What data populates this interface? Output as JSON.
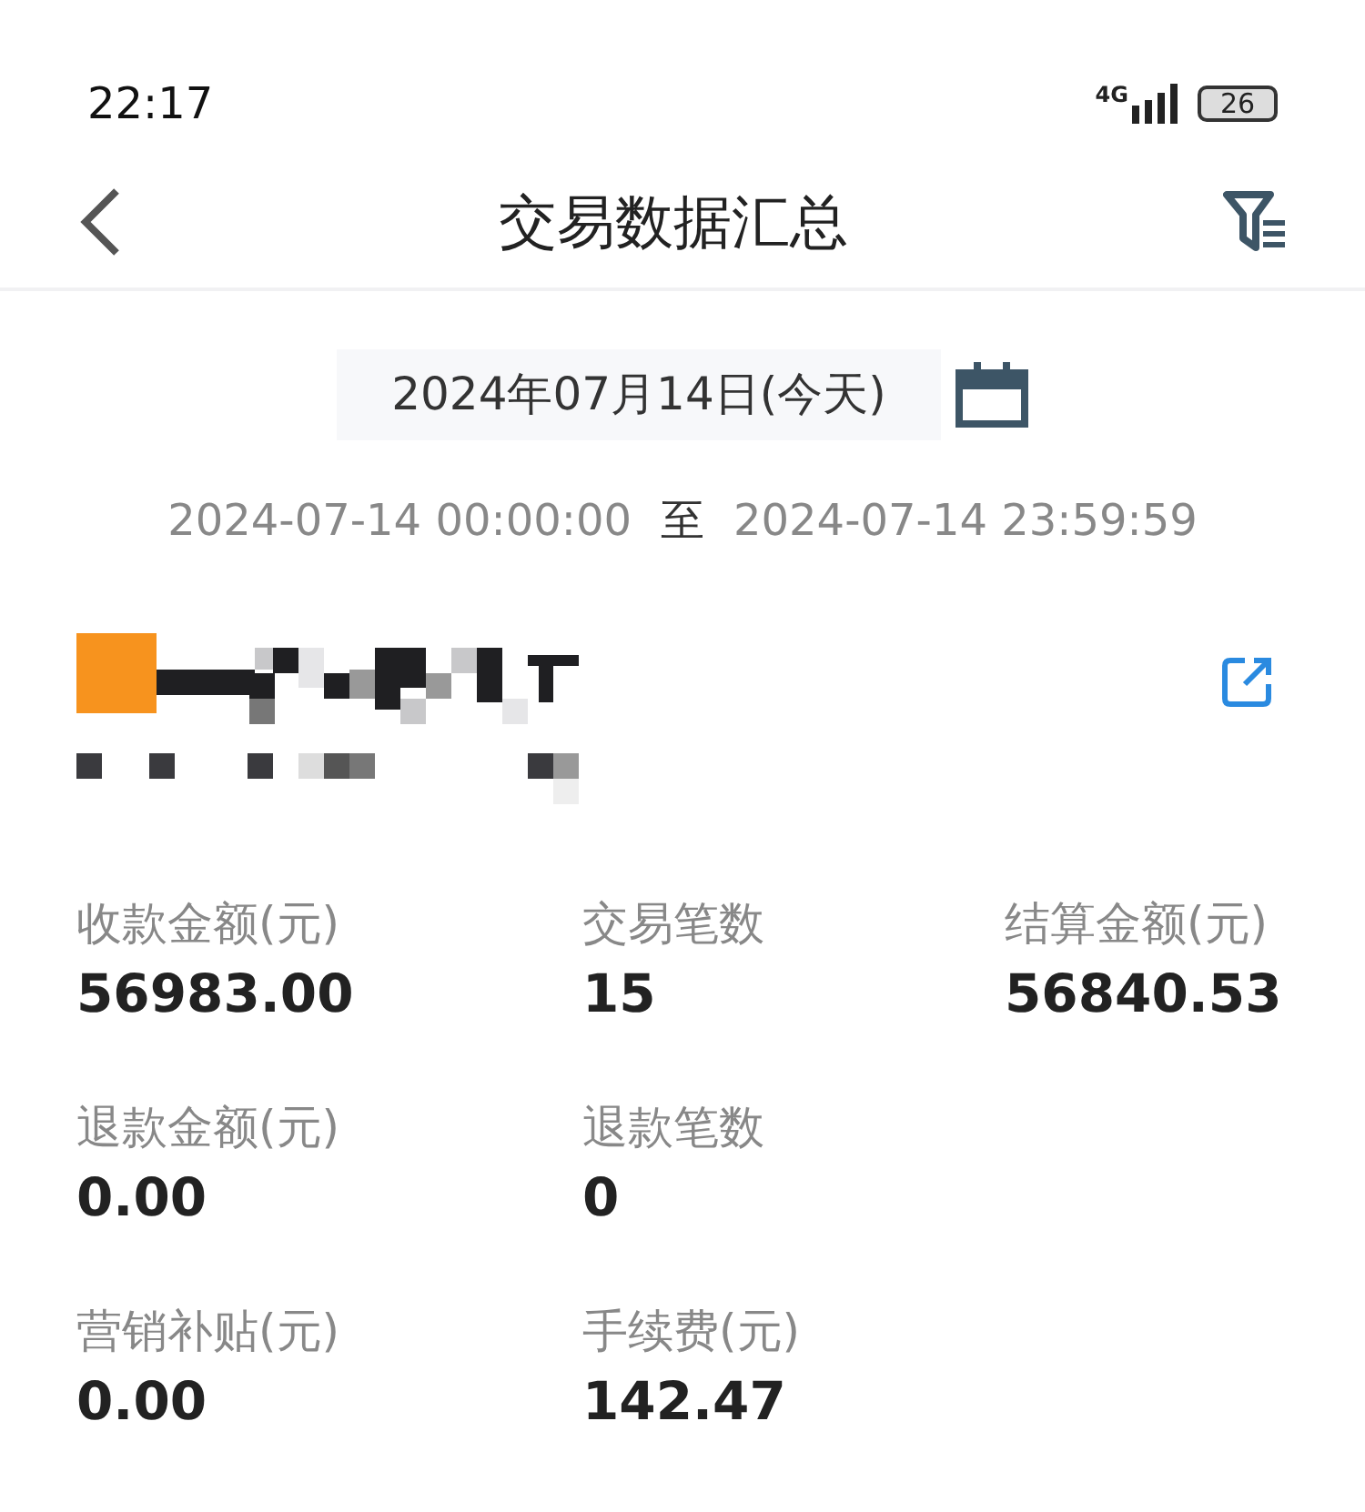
{
  "status_bar": {
    "time": "22:17",
    "network": "4G",
    "battery": "26"
  },
  "header": {
    "title": "交易数据汇总"
  },
  "date_picker": {
    "value": "2024年07月14日(今天)"
  },
  "range": {
    "start": "2024-07-14 00:00:00",
    "separator": "至",
    "end": "2024-07-14 23:59:59"
  },
  "metrics": [
    [
      {
        "label": "收款金额(元)",
        "value": "56983.00"
      },
      {
        "label": "交易笔数",
        "value": "15"
      },
      {
        "label": "结算金额(元)",
        "value": "56840.53"
      }
    ],
    [
      {
        "label": "退款金额(元)",
        "value": "0.00"
      },
      {
        "label": "退款笔数",
        "value": "0"
      }
    ],
    [
      {
        "label": "营销补贴(元)",
        "value": "0.00"
      },
      {
        "label": "手续费(元)",
        "value": "142.47"
      }
    ]
  ]
}
